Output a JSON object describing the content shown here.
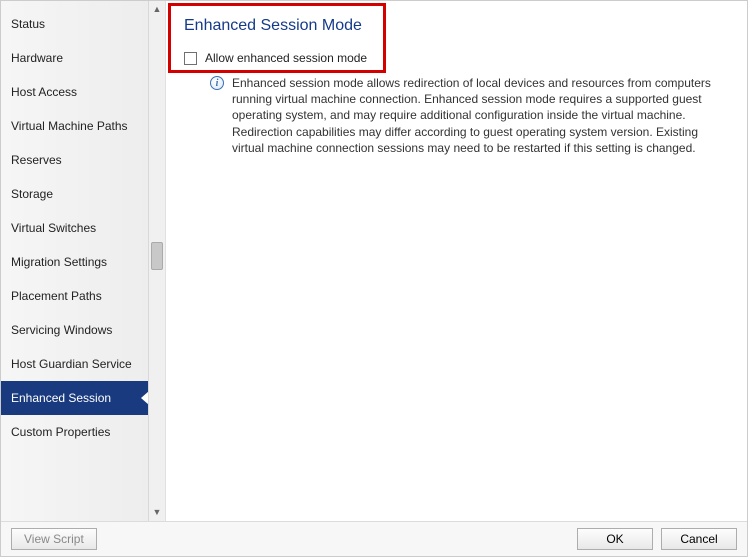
{
  "sidebar": {
    "items": [
      {
        "label": "Status"
      },
      {
        "label": "Hardware"
      },
      {
        "label": "Host Access"
      },
      {
        "label": "Virtual Machine Paths"
      },
      {
        "label": "Reserves"
      },
      {
        "label": "Storage"
      },
      {
        "label": "Virtual Switches"
      },
      {
        "label": "Migration Settings"
      },
      {
        "label": "Placement Paths"
      },
      {
        "label": "Servicing Windows"
      },
      {
        "label": "Host Guardian Service"
      },
      {
        "label": "Enhanced Session",
        "selected": true
      },
      {
        "label": "Custom Properties"
      }
    ]
  },
  "content": {
    "heading": "Enhanced Session Mode",
    "checkbox_label": "Allow enhanced session mode",
    "checkbox_checked": false,
    "info_text": "Enhanced session mode allows redirection of local devices and resources from computers running virtual machine connection. Enhanced session mode requires a supported guest operating system, and may require additional configuration inside the virtual machine. Redirection capabilities may differ according to guest operating system version. Existing virtual machine connection sessions may need to be restarted if this setting is changed."
  },
  "footer": {
    "view_script": "View Script",
    "ok": "OK",
    "cancel": "Cancel"
  },
  "colors": {
    "selected_bg": "#193a7f",
    "heading": "#153a8a",
    "highlight": "#d40000"
  }
}
